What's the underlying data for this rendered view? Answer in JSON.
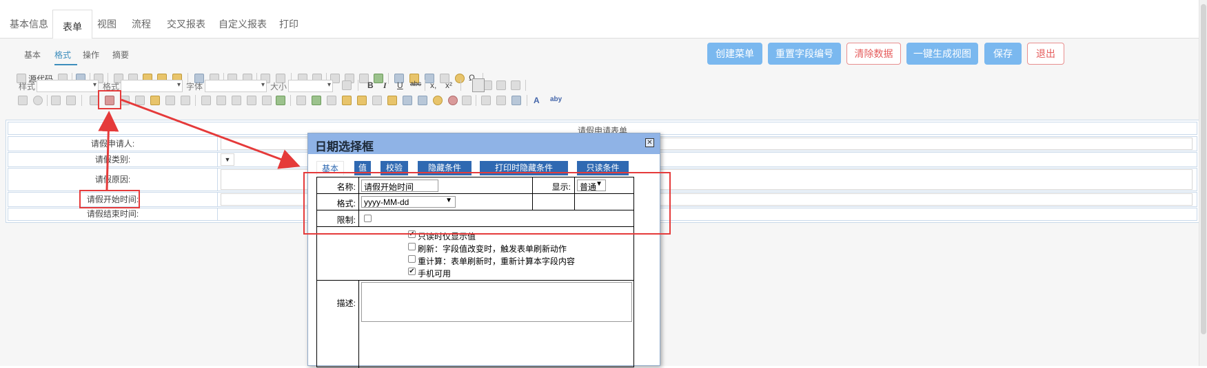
{
  "top_tabs": [
    "基本信息",
    "表单",
    "视图",
    "流程",
    "交叉报表",
    "自定义报表",
    "打印"
  ],
  "sub_tabs": [
    "基本",
    "格式",
    "操作",
    "摘要"
  ],
  "actions": {
    "create_menu": "创建菜单",
    "reset_field_no": "重置字段编号",
    "clear_data": "清除数据",
    "generate_view": "一键生成视图",
    "save": "保存",
    "exit": "退出"
  },
  "toolbar": {
    "source": "源代码",
    "style_label": "样式",
    "format_label": "格式",
    "font_label": "字体",
    "size_label": "大小",
    "bold": "B",
    "italic": "I",
    "underline": "U",
    "strike": "abc",
    "subscript": "x,",
    "superscript": "x²",
    "omega": "Ω",
    "font_color": "A",
    "bg_color": "aby"
  },
  "form": {
    "title": "请假申请表单",
    "rows": [
      "请假申请人:",
      "请假类别:",
      "请假原因:",
      "请假开始时间:",
      "请假结束时间:"
    ],
    "category_select": "▼"
  },
  "dialog": {
    "title": "日期选择框",
    "close": "✕",
    "tabs": [
      "基本",
      "值",
      "校验",
      "隐藏条件",
      "打印时隐藏条件",
      "只读条件"
    ],
    "name_label": "名称:",
    "name_value": "请假开始时间",
    "display_label": "显示:",
    "display_value": "普通",
    "format_label": "格式:",
    "format_value": "yyyy-MM-dd",
    "limit_label": "限制:",
    "options": [
      {
        "label": "只读时仅显示值",
        "checked": true
      },
      {
        "label": "刷新：字段值改变时，触发表单刷新动作",
        "checked": false
      },
      {
        "label": "重计算：表单刷新时，重新计算本字段内容",
        "checked": false
      },
      {
        "label": "手机可用",
        "checked": true
      }
    ],
    "desc_label": "描述:"
  },
  "colors": {
    "accent": "#3c8dbc",
    "button_blue": "#7ab8ef",
    "danger": "#e55c5c",
    "highlight_red": "#e53a3a",
    "dialog_header": "#8fb3e6",
    "dialog_tab": "#2f69b2"
  }
}
